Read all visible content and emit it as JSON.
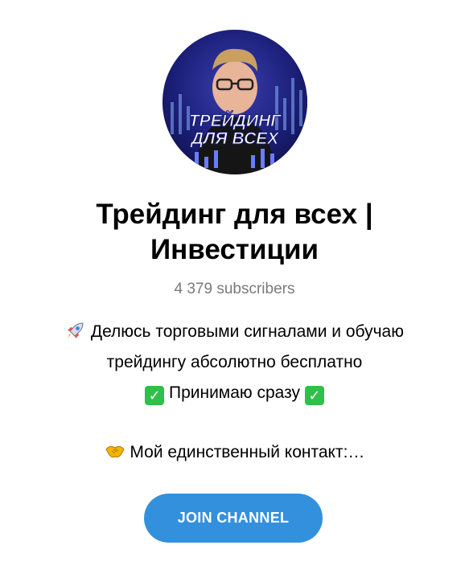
{
  "channel": {
    "avatar": {
      "name": "channel-avatar",
      "overlay_line1": "ТРЕЙДИНГ",
      "overlay_line2": "ДЛЯ ВСЕХ"
    },
    "title_line1": "Трейдинг для всех |",
    "title_line2": "Инвестиции",
    "subscribers": "4 379 subscribers"
  },
  "description": {
    "line1_icon": "rocket-icon",
    "line1_text": "Делюсь торговыми сигналами и обучаю",
    "line2_text": "трейдингу абсолютно бесплатно",
    "line3_icon": "check-mark-icon",
    "line3_text": "Принимаю сразу",
    "line4_icon": "handshake-icon",
    "line4_text": "Мой единственный контакт:…"
  },
  "actions": {
    "join_label": "JOIN CHANNEL"
  },
  "colors": {
    "accent": "#3390dc",
    "muted": "#7a7a7a",
    "check": "#2fbf4a"
  }
}
